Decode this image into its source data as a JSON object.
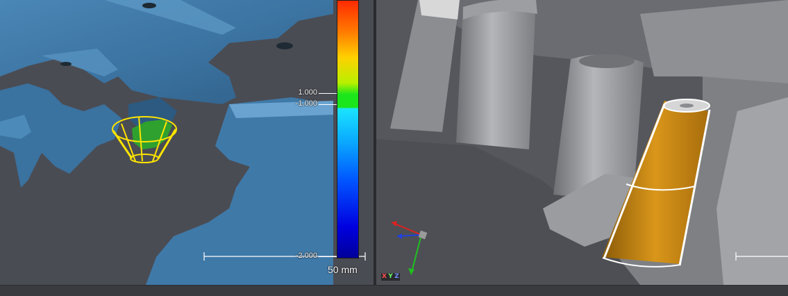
{
  "left_viewport": {
    "color_scale": {
      "labels": {
        "upper_tolerance": "1.000",
        "lower_tolerance": "-1.000",
        "lower_limit": "-2.000"
      }
    },
    "ruler": {
      "label": "50 mm"
    },
    "colors": {
      "surface": "#3f79a8",
      "surface_highlight": "#5f9bc8",
      "measurement": "#ffe400",
      "in_tolerance": "#2fa12f"
    }
  },
  "right_viewport": {
    "axis_triad": {
      "x": "X",
      "y": "Y",
      "z": "Z"
    },
    "colors": {
      "cad_gray": "#8f9195",
      "selected_feature": "#c98a12"
    }
  }
}
